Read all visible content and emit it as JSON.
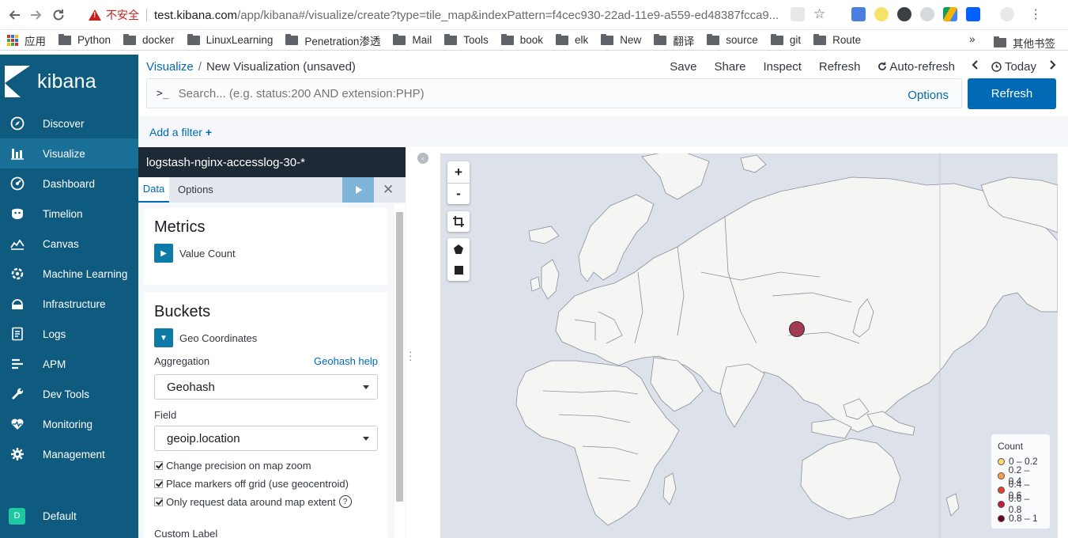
{
  "browser": {
    "insecure_label": "不安全",
    "url_domain": "test.kibana.com",
    "url_path": "/app/kibana#/visualize/create?type=tile_map&indexPattern=f4cec930-22ad-11e9-a559-ed48387fcca9..."
  },
  "bookmarks": {
    "apps": "应用",
    "items": [
      "Python",
      "docker",
      "LinuxLearning",
      "Penetration渗透",
      "Mail",
      "Tools",
      "book",
      "elk",
      "New",
      "翻译",
      "source",
      "git",
      "Route"
    ],
    "overflow": "»",
    "other": "其他书签"
  },
  "sidebar": {
    "brand": "kibana",
    "items": [
      {
        "label": "Discover",
        "icon": "compass-icon"
      },
      {
        "label": "Visualize",
        "icon": "bar-chart-icon"
      },
      {
        "label": "Dashboard",
        "icon": "dashboard-icon"
      },
      {
        "label": "Timelion",
        "icon": "timelion-icon"
      },
      {
        "label": "Canvas",
        "icon": "canvas-icon"
      },
      {
        "label": "Machine Learning",
        "icon": "ml-icon"
      },
      {
        "label": "Infrastructure",
        "icon": "infrastructure-icon"
      },
      {
        "label": "Logs",
        "icon": "logs-icon"
      },
      {
        "label": "APM",
        "icon": "apm-icon"
      },
      {
        "label": "Dev Tools",
        "icon": "wrench-icon"
      },
      {
        "label": "Monitoring",
        "icon": "heartbeat-icon"
      },
      {
        "label": "Management",
        "icon": "gear-icon"
      }
    ],
    "active_index": 1,
    "space_initial": "D",
    "space_label": "Default"
  },
  "header": {
    "breadcrumb_root": "Visualize",
    "breadcrumb_sep": "/",
    "breadcrumb_current": "New Visualization (unsaved)",
    "menu": [
      "Save",
      "Share",
      "Inspect",
      "Refresh"
    ],
    "auto_refresh": "Auto-refresh",
    "time_label": "Today"
  },
  "query": {
    "prompt": ">_",
    "placeholder": "Search... (e.g. status:200 AND extension:PHP)",
    "options_label": "Options",
    "refresh_label": "Refresh",
    "add_filter_label": "Add a filter"
  },
  "editor": {
    "index_pattern": "logstash-nginx-accesslog-30-*",
    "tabs": [
      "Data",
      "Options"
    ],
    "metrics": {
      "title": "Metrics",
      "agg_label": "Value Count"
    },
    "buckets": {
      "title": "Buckets",
      "agg_label": "Geo Coordinates",
      "aggregation_label": "Aggregation",
      "help_link": "Geohash help",
      "aggregation_value": "Geohash",
      "field_label": "Field",
      "field_value": "geoip.location",
      "checks": [
        "Change precision on map zoom",
        "Place markers off grid (use geocentroid)",
        "Only request data around map extent"
      ],
      "help_icon": "?",
      "custom_label": "Custom Label"
    }
  },
  "map": {
    "zoom_in": "+",
    "zoom_out": "-",
    "legend": {
      "title": "Count",
      "ranges": [
        {
          "label": "0 – 0.2",
          "color": "#ffd966"
        },
        {
          "label": "0.2 – 0.4",
          "color": "#f99d46"
        },
        {
          "label": "0.4 – 0.6",
          "color": "#e3452c"
        },
        {
          "label": "0.6 – 0.8",
          "color": "#c51b3a"
        },
        {
          "label": "0.8 – 1",
          "color": "#6e0028"
        }
      ]
    },
    "marker_color": "#a33a54"
  }
}
